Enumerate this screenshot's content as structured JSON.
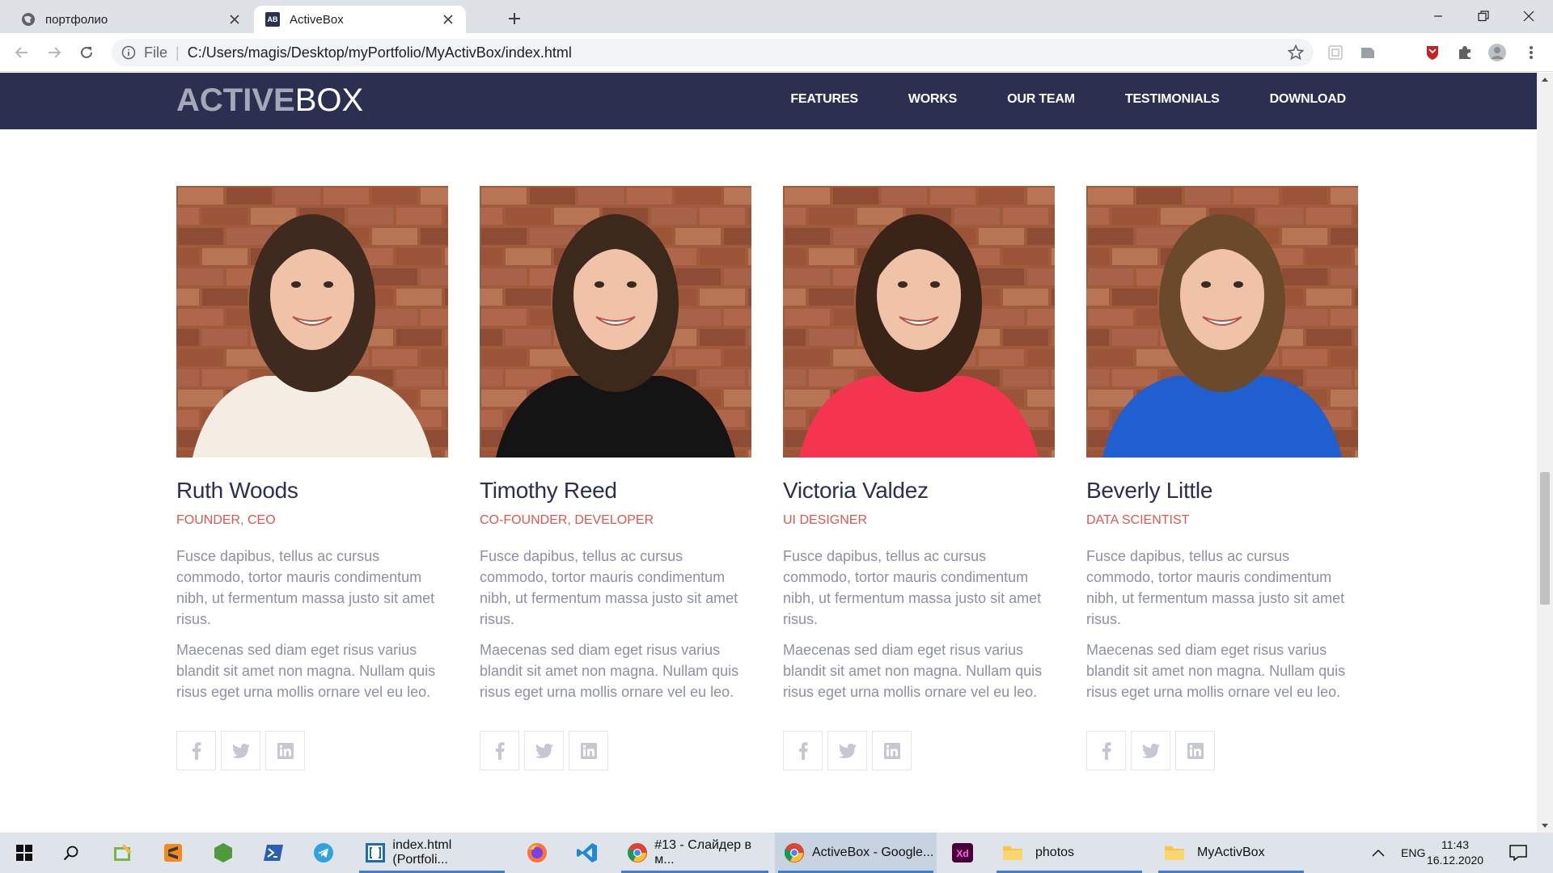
{
  "browser": {
    "tabs": [
      {
        "title": "портфолио",
        "active": false,
        "icon": "globe-icon"
      },
      {
        "title": "ActiveBox",
        "active": true,
        "icon": "ab-favicon",
        "favicon_text": "AB"
      }
    ],
    "address": {
      "scheme": "File",
      "url": "C:/Users/magis/Desktop/myPortfolio/MyActivBox/index.html"
    }
  },
  "site": {
    "logo": {
      "strong": "ACTIVE",
      "thin": "BOX"
    },
    "nav": [
      "FEATURES",
      "WORKS",
      "OUR TEAM",
      "TESTIMONIALS",
      "DOWNLOAD"
    ],
    "team": [
      {
        "name": "Ruth Woods",
        "role": "FOUNDER, CEO",
        "p1": "Fusce dapibus, tellus ac cursus commodo, tortor mauris condimentum nibh, ut fermentum massa justo sit amet risus.",
        "p2": "Maecenas sed diam eget risus varius blandit sit amet non magna. Nullam quis risus eget urna mollis ornare vel eu leo.",
        "shirt_color": "#f3ede4",
        "hair_color": "#3e2a1f"
      },
      {
        "name": "Timothy Reed",
        "role": "CO-FOUNDER, DEVELOPER",
        "p1": "Fusce dapibus, tellus ac cursus commodo, tortor mauris condimentum nibh, ut fermentum massa justo sit amet risus.",
        "p2": "Maecenas sed diam eget risus varius blandit sit amet non magna. Nullam quis risus eget urna mollis ornare vel eu leo.",
        "shirt_color": "#141414",
        "hair_color": "#3b2a1c"
      },
      {
        "name": "Victoria Valdez",
        "role": "UI DESIGNER",
        "p1": "Fusce dapibus, tellus ac cursus commodo, tortor mauris condimentum nibh, ut fermentum massa justo sit amet risus.",
        "p2": "Maecenas sed diam eget risus varius blandit sit amet non magna. Nullam quis risus eget urna mollis ornare vel eu leo.",
        "shirt_color": "#f5344f",
        "hair_color": "#3a2417"
      },
      {
        "name": "Beverly Little",
        "role": "DATA SCIENTIST",
        "p1": "Fusce dapibus, tellus ac cursus commodo, tortor mauris condimentum nibh, ut fermentum massa justo sit amet risus.",
        "p2": "Maecenas sed diam eget risus varius blandit sit amet non magna. Nullam quis risus eget urna mollis ornare vel eu leo.",
        "shirt_color": "#1f5fd0",
        "hair_color": "#6b4a2c"
      }
    ],
    "social_icons": [
      "facebook-icon",
      "twitter-icon",
      "linkedin-icon"
    ],
    "colors": {
      "header_bg": "#2c3050",
      "accent": "#e9534e",
      "body_text": "#8c90a4",
      "heading": "#2c3050"
    }
  },
  "taskbar": {
    "apps": [
      {
        "label": "index.html (Portfoli...",
        "icon": "brackets-icon"
      },
      {
        "label": "#13 - Слайдер в м...",
        "icon": "chrome-icon"
      },
      {
        "label": "ActiveBox - Google...",
        "icon": "chrome-icon",
        "active": true
      },
      {
        "label": "photos",
        "icon": "folder-icon"
      },
      {
        "label": "MyActivBox",
        "icon": "folder-icon"
      }
    ],
    "lang": "ENG",
    "time": "11:43",
    "date": "16.12.2020"
  }
}
